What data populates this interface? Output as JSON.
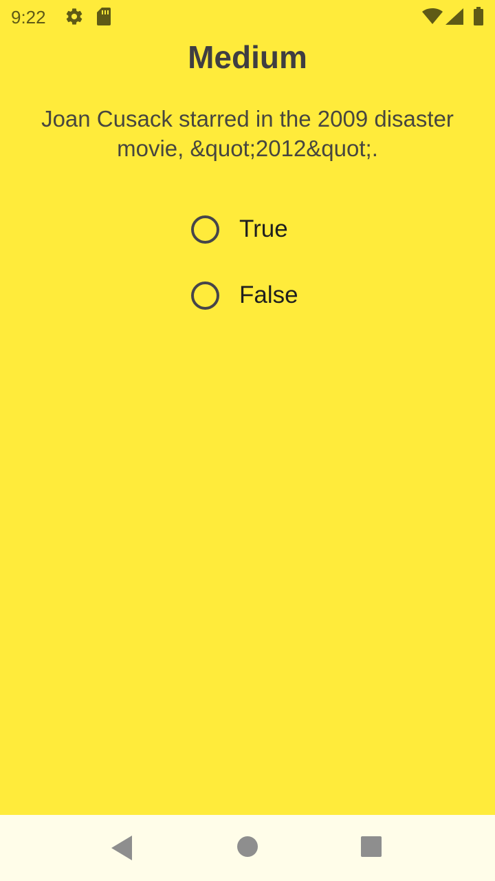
{
  "status_bar": {
    "time": "9:22",
    "icons": [
      "gear-icon",
      "sd-card-icon",
      "wifi-icon",
      "signal-icon",
      "battery-icon"
    ]
  },
  "quiz": {
    "difficulty": "Medium",
    "question": "Joan Cusack starred in the 2009 disaster movie, &quot;2012&quot;.",
    "options": [
      {
        "label": "True",
        "selected": false
      },
      {
        "label": "False",
        "selected": false
      }
    ]
  },
  "nav_bar": {
    "buttons": [
      "back-icon",
      "home-icon",
      "recents-icon"
    ]
  },
  "colors": {
    "background": "#FFEB3B",
    "nav_background": "#FFFDE9",
    "text": "#3f3e42"
  }
}
